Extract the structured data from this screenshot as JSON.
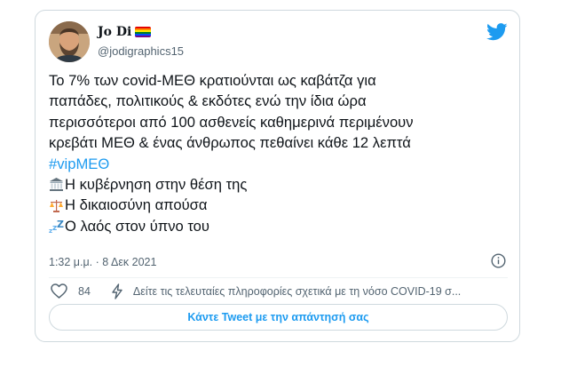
{
  "author": {
    "display_name": "Jo Di",
    "handle": "@jodigraphics15",
    "avatar_icon": "person-avatar",
    "flag_icon": "rainbow-flag-icon"
  },
  "brand": {
    "icon": "twitter-bird-icon",
    "color": "#1d9bf0"
  },
  "tweet": {
    "lines": [
      "Το 7% των covid-ΜΕΘ κρατιούνται ως καβάτζα για",
      "παπάδες, πολιτικούς & εκδότες ενώ την ίδια ώρα",
      "περισσότεροι από 100 ασθενείς καθημερινά περιμένουν",
      "κρεβάτι ΜΕΘ & ένας άνθρωπος πεθαίνει κάθε 12 λεπτά"
    ],
    "hashtag": "#vipΜΕΘ",
    "emoji_lines": [
      {
        "icon": "classical-building-icon",
        "text": "Η κυβέρνηση στην θέση της"
      },
      {
        "icon": "balance-scale-icon",
        "text": "Η δικαιοσύνη απούσα"
      },
      {
        "icon": "sleeping-zzz-icon",
        "text": "Ο λαός στον ύπνο του"
      }
    ]
  },
  "meta": {
    "timestamp": "1:32 μ.μ. · 8 Δεκ 2021",
    "info_icon": "info-icon"
  },
  "actions": {
    "like_count": "84",
    "covid_notice": "Δείτε τις τελευταίες πληροφορίες σχετικά με τη νόσο COVID-19 σ..."
  },
  "reply_button_label": "Κάντε Tweet με την απάντησή σας"
}
